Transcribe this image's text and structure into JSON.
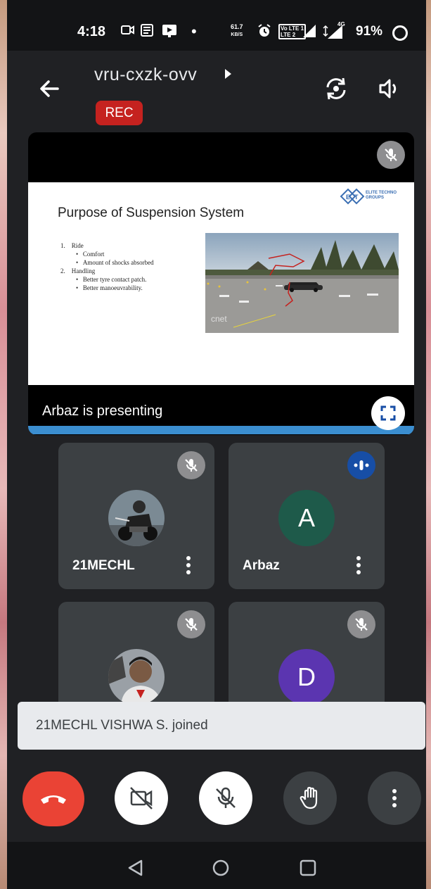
{
  "status_bar": {
    "time": "4:18",
    "net_speed_value": "61.7",
    "net_speed_unit": "KB/S",
    "lte_line1": "Vo LTE 1",
    "lte_line2": "LTE 2",
    "network": "4G",
    "battery": "91%"
  },
  "header": {
    "meeting_code": "vru-cxzk-ovv",
    "rec_label": "REC",
    "icons": [
      "back-arrow-icon",
      "switch-camera-icon",
      "speaker-icon"
    ]
  },
  "presentation": {
    "slide_title": "Purpose of Suspension System",
    "slide_logo_text_1": "ELITE TECHNO",
    "slide_logo_text_2": "GROUPS",
    "slide_items": [
      {
        "num": "1.",
        "text": "Ride",
        "subs": [
          "Comfort",
          "Amount of shocks absorbed"
        ]
      },
      {
        "num": "2.",
        "text": "Handling",
        "subs": [
          "Better tyre contact patch.",
          "Better manoeuvrability."
        ]
      }
    ],
    "photo_watermark": "cnet",
    "presenting_label": "Arbaz is presenting"
  },
  "participants": [
    {
      "name": "21MECHL",
      "avatar": "photo",
      "status": "muted"
    },
    {
      "name": "Arbaz",
      "avatar": "letter",
      "letter": "A",
      "avatar_color": "#1e5a4a",
      "status": "speaking"
    },
    {
      "name": "",
      "avatar": "photo",
      "status": "muted"
    },
    {
      "name": "",
      "avatar": "letter",
      "letter": "D",
      "avatar_color": "#5b35b0",
      "status": "muted"
    }
  ],
  "toast": {
    "text": "21MECHL VISHWA S. joined"
  },
  "controls": {
    "end_call_color": "#ea4335",
    "buttons": [
      "end-call-icon",
      "camera-off-icon",
      "mic-off-icon",
      "raise-hand-icon",
      "more-options-icon"
    ]
  },
  "colors": {
    "background": "#202124",
    "tile": "#3c4043",
    "rec": "#c5221f",
    "speaking": "#174ea6",
    "slide_bar": "#3b8ed0"
  }
}
